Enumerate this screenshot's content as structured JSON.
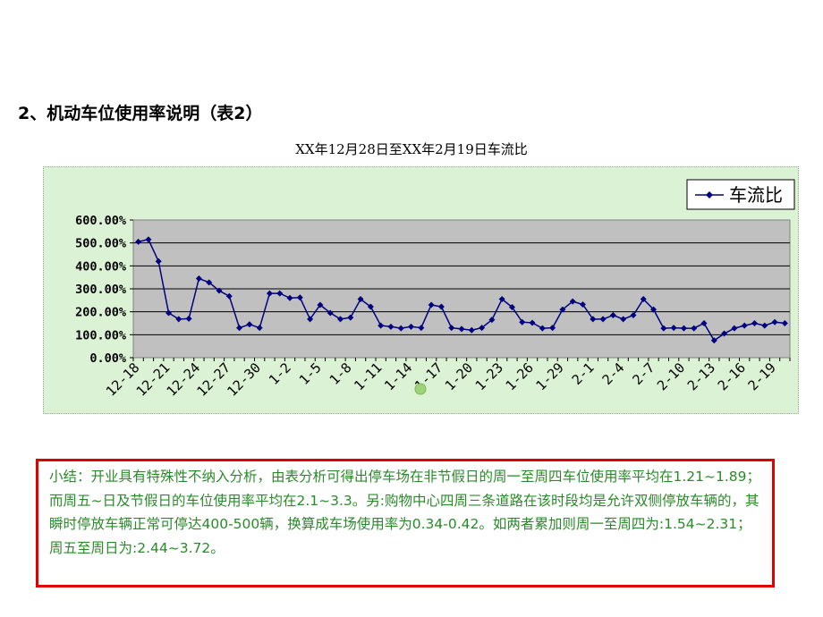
{
  "heading": "2、机动车位使用率说明（表2）",
  "chart_title": "XX年12月28日至XX年2月19日车流比",
  "summary_text": "小结：开业具有特殊性不纳入分析，由表分析可得出停车场在非节假日的周一至周四车位使用率平均在1.21~1.89；而周五~日及节假日的车位使用率平均在2.1~3.3。另:购物中心四周三条道路在该时段均是允许双侧停放车辆的，其瞬时停放车辆正常可停达400-500辆，换算成车场使用率为0.34-0.42。如两者累加则周一至周四为:1.54~2.31；周五至周日为:2.44~3.72。",
  "colors": {
    "chart_bg": "#dcf2d4",
    "plot_bg": "#c0c0c0",
    "series": "#000080",
    "summary_border": "#e00000",
    "summary_text": "#2a8a2a"
  },
  "chart_data": {
    "type": "line",
    "title": "XX年12月28日至XX年2月19日车流比",
    "xlabel": "",
    "ylabel": "",
    "ylim": [
      0,
      600
    ],
    "y_ticks": [
      "0.00%",
      "100.00%",
      "200.00%",
      "300.00%",
      "400.00%",
      "500.00%",
      "600.00%"
    ],
    "grid": "horizontal",
    "legend_position": "top-right",
    "x_tick_labels": [
      "12-18",
      "12-21",
      "12-24",
      "12-27",
      "12-30",
      "1-2",
      "1-5",
      "1-8",
      "1-11",
      "1-14",
      "1-17",
      "1-20",
      "1-23",
      "1-26",
      "1-29",
      "2-1",
      "2-4",
      "2-7",
      "2-10",
      "2-13",
      "2-16",
      "2-19"
    ],
    "categories": [
      "12-18",
      "12-19",
      "12-20",
      "12-21",
      "12-22",
      "12-23",
      "12-24",
      "12-25",
      "12-26",
      "12-27",
      "12-28",
      "12-29",
      "12-30",
      "12-31",
      "1-1",
      "1-2",
      "1-3",
      "1-4",
      "1-5",
      "1-6",
      "1-7",
      "1-8",
      "1-9",
      "1-10",
      "1-11",
      "1-12",
      "1-13",
      "1-14",
      "1-15",
      "1-16",
      "1-17",
      "1-18",
      "1-19",
      "1-20",
      "1-21",
      "1-22",
      "1-23",
      "1-24",
      "1-25",
      "1-26",
      "1-27",
      "1-28",
      "1-29",
      "1-30",
      "1-31",
      "2-1",
      "2-2",
      "2-3",
      "2-4",
      "2-5",
      "2-6",
      "2-7",
      "2-8",
      "2-9",
      "2-10",
      "2-11",
      "2-12",
      "2-13",
      "2-14",
      "2-15",
      "2-16",
      "2-17",
      "2-18",
      "2-19",
      "2-20"
    ],
    "series": [
      {
        "name": "车流比",
        "values": [
          505,
          515,
          420,
          195,
          168,
          170,
          345,
          328,
          292,
          268,
          130,
          145,
          130,
          280,
          280,
          260,
          262,
          168,
          230,
          195,
          168,
          175,
          255,
          222,
          140,
          135,
          128,
          135,
          130,
          230,
          222,
          130,
          125,
          120,
          130,
          165,
          255,
          220,
          155,
          152,
          128,
          130,
          210,
          245,
          232,
          168,
          168,
          185,
          168,
          185,
          255,
          210,
          128,
          130,
          128,
          128,
          150,
          75,
          105,
          128,
          140,
          150,
          140,
          155,
          150
        ]
      }
    ]
  }
}
